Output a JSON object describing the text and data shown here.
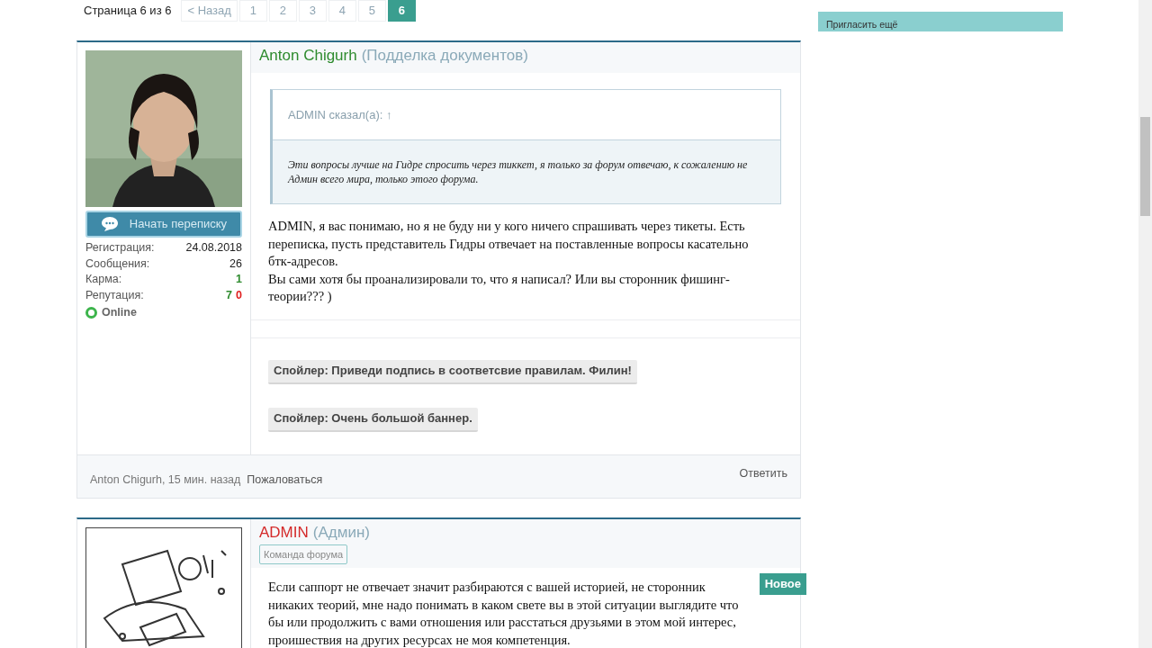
{
  "pagination": {
    "label": "Страница 6 из 6",
    "prev": {
      "label": "< Назад",
      "disabled": true
    },
    "pages": [
      {
        "label": "1",
        "selected": false
      },
      {
        "label": "2",
        "selected": false
      },
      {
        "label": "3",
        "selected": false
      },
      {
        "label": "4",
        "selected": false
      },
      {
        "label": "5",
        "selected": false
      },
      {
        "label": "6",
        "selected": true
      }
    ]
  },
  "posts": [
    {
      "author": "Anton Chigurh",
      "color": "#2e8b2e",
      "title": "(Подделка документов)",
      "message_button": "Начать переписку",
      "stats": [
        {
          "label": "Регистрация:",
          "values": [
            {
              "text": "24.08.2018",
              "color": "#222222"
            }
          ]
        },
        {
          "label": "Сообщения:",
          "values": [
            {
              "text": "26",
              "color": "#222222"
            }
          ]
        },
        {
          "label": "Карма:",
          "values": [
            {
              "text": "1",
              "color": "#2e8b2e"
            }
          ]
        },
        {
          "label": "Репутация:",
          "values": [
            {
              "text": "7",
              "color": "#2e8b2e"
            },
            {
              "text": "0",
              "color": "#e02020"
            }
          ]
        }
      ],
      "online": {
        "on": true,
        "label": "Online"
      },
      "quote": {
        "attribution": "ADMIN сказал(а): ↑",
        "text": "Эти вопросы лучше на Гидре спросить через тиккет, я только за форум отвечаю, к сожалению не Админ всего мира, только этого форума."
      },
      "paragraphs": [
        "ADMIN, я вас понимаю, но я не буду ни у кого ничего спрашивать через тикеты. Есть переписка, пусть представитель Гидры отвечает на поставленные вопросы касательно бтк-адресов.",
        "Вы сами хотя бы проанализировали то, что я написал? Или вы сторонник фишинг-теории??? )"
      ],
      "spoilers": [
        "Спойлер: Приведи подпись в соответсвие правилам. Филин!",
        "Спойлер: Очень большой баннер."
      ],
      "footer": {
        "meta": "Anton Chigurh, 15 мин. назад",
        "report": "Пожаловаться",
        "reply": "Ответить"
      }
    },
    {
      "author": "ADMIN",
      "color": "#d42a2a",
      "title": "(Админ)",
      "badge": "Команда форума",
      "new_label": "Новое",
      "paragraphs": [
        "Если саппорт не отвечает значит разбираются с вашей историей, не сторонник никаких теорий, мне надо понимать в каком свете вы в этой ситуации выглядите что бы или продолжить с вами отношения или расстаться друзьями в этом мой интерес, проишествия на других ресурсах не моя компетенция."
      ]
    }
  ],
  "sidebar": {
    "invite_button": "Пригласить ещё"
  }
}
